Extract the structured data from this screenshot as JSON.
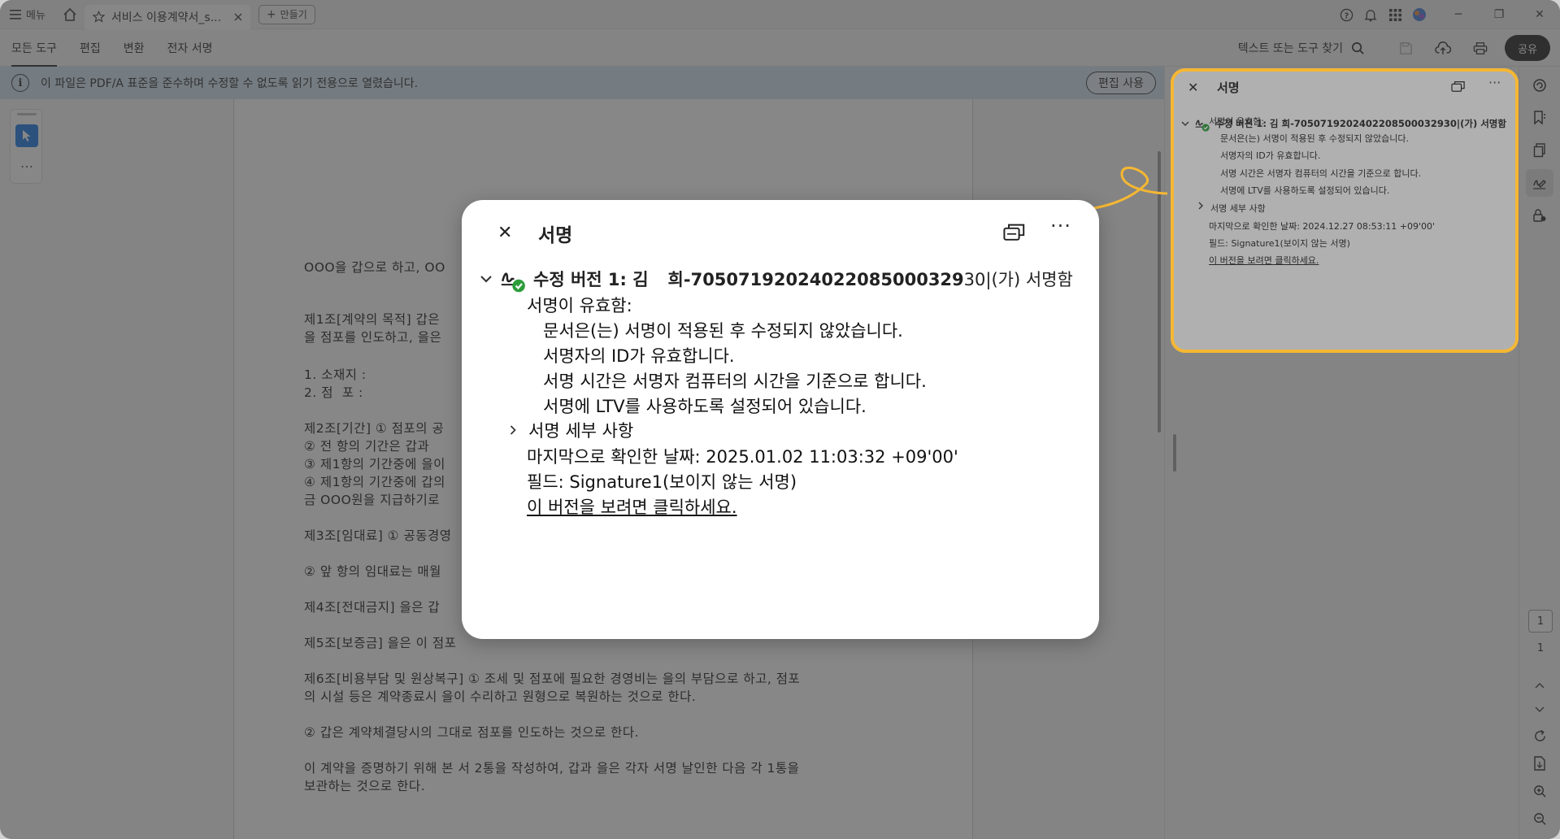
{
  "titlebar": {
    "menu_label": "메뉴",
    "tab_title": "서비스 이용계약서_s...",
    "new_tab_label": "만들기",
    "close_icon": "close-icon",
    "window_controls": [
      "─",
      "❐",
      "✕"
    ]
  },
  "toolbar": {
    "tabs": [
      "모든 도구",
      "편집",
      "변환",
      "전자 서명"
    ],
    "find_label": "텍스트 또는 도구 찾기",
    "share_label": "공유"
  },
  "infobar": {
    "message": "이 파일은 PDF/A 표준을 준수하며 수정할 수 없도록 읽기 전용으로 열렸습니다.",
    "edit_button": "편집 사용"
  },
  "left_tools": {
    "more": "…"
  },
  "document": {
    "lines": [
      "OOO을 갑으로 하고, OO",
      "제1조[계약의 목적] 갑은",
      "을 점포를 인도하고, 을은",
      "1. 소재지 :",
      "2. 점  포 :",
      "제2조[기간] ① 점포의 공",
      "② 전 항의 기간은 갑과",
      "③ 제1항의 기간중에 을이",
      "④ 제1항의 기간중에 갑의",
      "금 OOO원을 지급하기로",
      "제3조[임대료] ① 공동경영",
      "② 앞 항의 임대료는 매월",
      "제4조[전대금지] 을은 갑",
      "제5조[보증금] 을은 이 점포",
      "제6조[비용부담 및 원상복구] ① 조세 및 점포에 필요한 경영비는 을의 부담으로 하고, 점포",
      "의 시설 등은 계약종료시 을이 수리하고 원형으로 복원하는 것으로 한다.",
      "② 갑은 계약체결당시의 그대로 점포를 인도하는 것으로 한다.",
      "이 계약을 증명하기 위해 본 서 2통을 작성하여, 갑과 을은 각자 서명 날인한 다음 각 1통을",
      "보관하는 것으로 한다."
    ]
  },
  "signature_panel": {
    "title": "서명",
    "version_header": "수정 버전 1: 김    희-7050719202402208500032930|(가) 서명함",
    "valid_label": "서명이 유효함:",
    "details": [
      "문서은(는) 서명이 적용된 후 수정되지 않았습니다.",
      "서명자의 ID가 유효합니다.",
      "서명 시간은 서명자 컴퓨터의 시간을 기준으로 합니다.",
      "서명에 LTV를 사용하도록 설정되어 있습니다."
    ],
    "sig_details_label": "서명 세부 사항",
    "last_checked": "마지막으로 확인한 날짜: 2024.12.27 08:53:11 +09'00'",
    "field": "필드: Signature1(보이지 않는 서명)",
    "view_link": "이 버전을 보려면 클릭하세요."
  },
  "popup": {
    "title": "서명",
    "version_prefix": "수정 버전 1: 김",
    "version_id": "희-70507192024022085000329",
    "version_suffix": "30|(가) 서명함",
    "valid_label": "서명이 유효함:",
    "details": [
      "문서은(는) 서명이 적용된 후 수정되지 않았습니다.",
      "서명자의 ID가 유효합니다.",
      "서명 시간은 서명자 컴퓨터의 시간을 기준으로 합니다.",
      "서명에 LTV를 사용하도록 설정되어 있습니다."
    ],
    "sig_details_label": "서명 세부 사항",
    "last_checked": "마지막으로 확인한 날짜: 2025.01.02 11:03:32 +09'00'",
    "field": "필드: Signature1(보이지 않는 서명)",
    "view_link": "이 버전을 보려면 클릭하세요.",
    "more": "···"
  },
  "page_nav": {
    "current": "1",
    "total": "1"
  },
  "colors": {
    "accent": "#1473e6",
    "highlight": "#f5b733",
    "infobar": "#cfe0ef",
    "valid_green": "#2d9d3a"
  }
}
